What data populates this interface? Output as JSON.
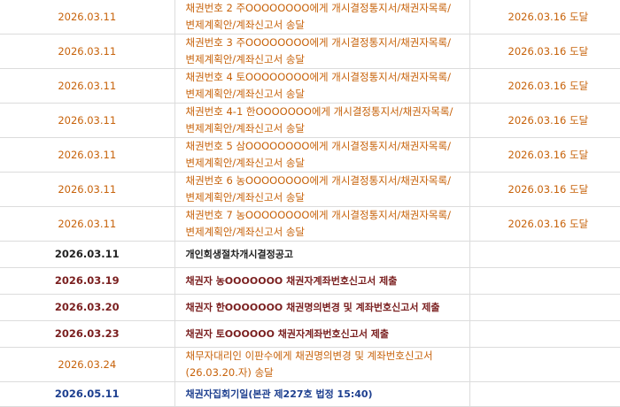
{
  "rows": [
    {
      "date": "2026.03.11",
      "content": "채권번호 2 주OOOOOOOO에게 개시결정통지서/채권자목록/변제계획안/계좌신고서 송달",
      "result": "2026.03.16 도달",
      "style": "orange"
    },
    {
      "date": "2026.03.11",
      "content": "채권번호 3 주OOOOOOOO에게 개시결정통지서/채권자목록/변제계획안/계좌신고서 송달",
      "result": "2026.03.16 도달",
      "style": "orange"
    },
    {
      "date": "2026.03.11",
      "content": "채권번호 4 토OOOOOOOO에게 개시결정통지서/채권자목록/변제계획안/계좌신고서 송달",
      "result": "2026.03.16 도달",
      "style": "orange"
    },
    {
      "date": "2026.03.11",
      "content": "채권번호 4-1 한OOOOOOO에게 개시결정통지서/채권자목록/변제계획안/계좌신고서 송달",
      "result": "2026.03.16 도달",
      "style": "orange"
    },
    {
      "date": "2026.03.11",
      "content": "채권번호 5 삼OOOOOOOO에게 개시결정통지서/채권자목록/변제계획안/계좌신고서 송달",
      "result": "2026.03.16 도달",
      "style": "orange"
    },
    {
      "date": "2026.03.11",
      "content": "채권번호 6 농OOOOOOOO에게 개시결정통지서/채권자목록/변제계획안/계좌신고서 송달",
      "result": "2026.03.16 도달",
      "style": "orange"
    },
    {
      "date": "2026.03.11",
      "content": "채권번호 7 농OOOOOOOO에게 개시결정통지서/채권자목록/변제계획안/계좌신고서 송달",
      "result": "2026.03.16 도달",
      "style": "orange"
    },
    {
      "date": "2026.03.11",
      "content": "개인회생절차개시결정공고",
      "result": "",
      "style": "black bold"
    },
    {
      "date": "2026.03.19",
      "content": "채권자 농OOOOOOO 채권자계좌번호신고서 제출",
      "result": "",
      "style": "maroon bold"
    },
    {
      "date": "2026.03.20",
      "content": "채권자 한OOOOOOO 채권명의변경 및 계좌번호신고서 제출",
      "result": "",
      "style": "maroon bold"
    },
    {
      "date": "2026.03.23",
      "content": "채권자 토OOOOOO 채권자계좌번호신고서 제출",
      "result": "",
      "style": "maroon bold"
    },
    {
      "date": "2026.03.24",
      "content": "채무자대리인 이판수에게 채권명의변경 및 계좌번호신고서(26.03.20.자) 송달",
      "result": "",
      "style": "orange"
    },
    {
      "date": "2026.05.11",
      "content": "채권자집회기일(본관 제227호 법정 15:40)",
      "result": "",
      "style": "blue bold"
    }
  ]
}
